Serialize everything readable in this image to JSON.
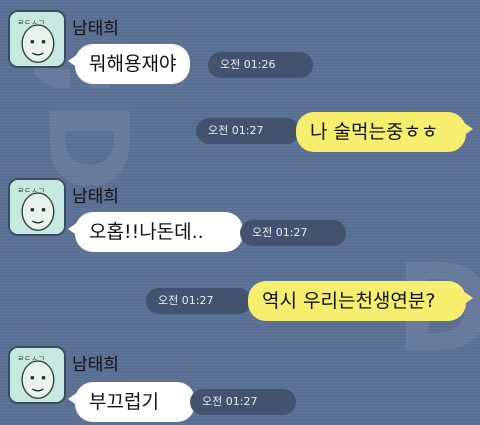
{
  "chat": {
    "bg_color": "#5b6f94",
    "incoming_color": "#ffffff",
    "outgoing_color": "#f6ee6f",
    "messages": [
      {
        "sender": "남태희",
        "text": "뭐해용재야",
        "time": "오전 01:26",
        "direction": "incoming",
        "avatar_icon": "profile-face-icon"
      },
      {
        "text": "나 술먹는중ㅎㅎ",
        "time": "오전 01:27",
        "direction": "outgoing"
      },
      {
        "sender": "남태희",
        "text": "오홉!!나돈데..",
        "time": "오전 01:27",
        "direction": "incoming",
        "avatar_icon": "profile-face-icon"
      },
      {
        "text": "역시 우리는천생연분?",
        "time": "오전 01:27",
        "direction": "outgoing"
      },
      {
        "sender": "남태희",
        "text": "부끄럽기",
        "time": "오전 01:27",
        "direction": "incoming",
        "avatar_icon": "profile-face-icon"
      }
    ]
  }
}
